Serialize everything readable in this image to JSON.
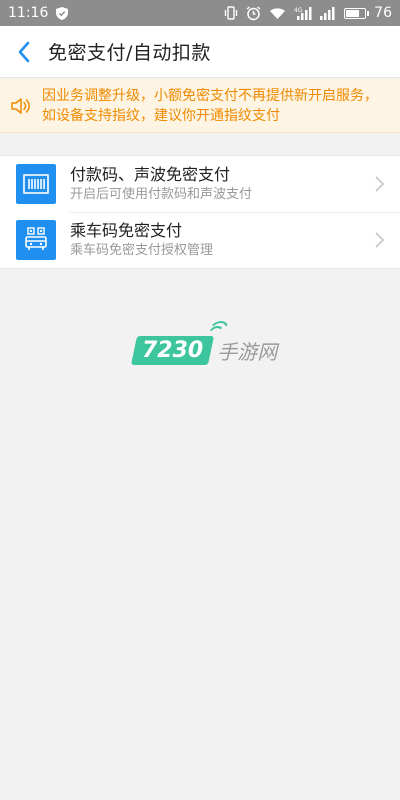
{
  "statusbar": {
    "time": "11:16",
    "battery": "76",
    "network_label": "4G"
  },
  "header": {
    "title": "免密支付/自动扣款"
  },
  "notice": {
    "text": "因业务调整升级，小额免密支付不再提供新开启服务，如设备支持指纹，建议你开通指纹支付"
  },
  "list": {
    "items": [
      {
        "title": "付款码、声波免密支付",
        "subtitle": "开启后可使用付款码和声波支付",
        "icon": "barcode-icon"
      },
      {
        "title": "乘车码免密支付",
        "subtitle": "乘车码免密支付授权管理",
        "icon": "bus-code-icon"
      }
    ]
  },
  "watermark": {
    "badge": "7230",
    "text": "手游网"
  },
  "colors": {
    "accent": "#1f8ff0",
    "notice_text": "#f08a00",
    "notice_bg": "#fdf4e4",
    "statusbar_bg": "#8d8d8d",
    "watermark_green": "#3dc59e"
  }
}
